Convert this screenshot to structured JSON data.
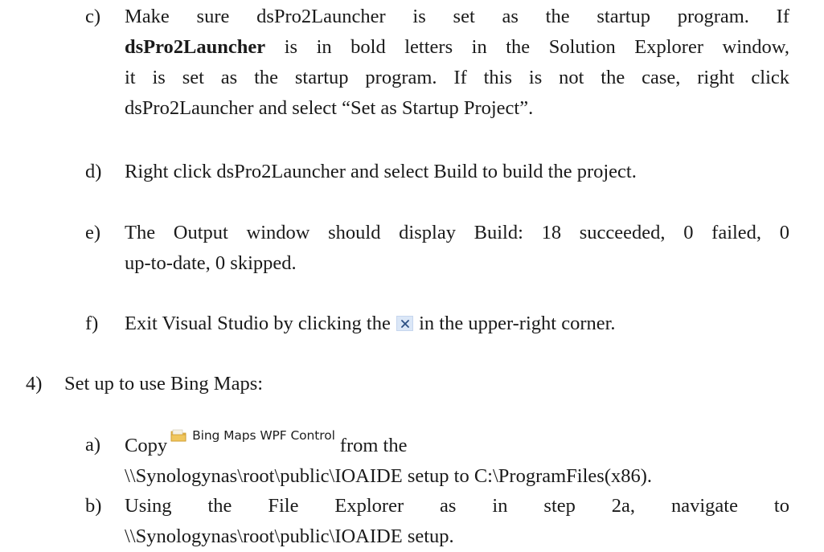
{
  "items": {
    "c": {
      "marker": "c)",
      "line1": "Make sure dsPro2Launcher is set as the startup program. If",
      "line2_bold": "dsPro2Launcher",
      "line2_rest": " is in bold letters in the Solution Explorer window,",
      "line3": "it is set as the startup program. If this is not the case, right click",
      "line4": "dsPro2Launcher and select “Set as Startup Project”."
    },
    "d": {
      "marker": "d)",
      "line1": "Right click dsPro2Launcher and select Build to build the project."
    },
    "e": {
      "marker": "e)",
      "line1": "The Output window should display Build: 18 succeeded, 0 failed, 0",
      "line2": "up-to-date, 0 skipped."
    },
    "f": {
      "marker": "f)",
      "before_icon": "Exit Visual Studio by clicking the",
      "after_icon": "in the upper-right corner.",
      "icon": "close-icon"
    },
    "step4": {
      "marker": "4)",
      "text": "Set up to use Bing Maps:"
    },
    "a4": {
      "marker": "a)",
      "before_folder": "Copy",
      "folder_icon": "folder-icon",
      "folder_label": "Bing Maps WPF Control",
      "after_folder": "from the",
      "line2": "\\\\Synologynas\\root\\public\\IOAIDE setup to C:\\ProgramFiles(x86)."
    },
    "b4": {
      "marker": "b)",
      "line1": "Using the File Explorer as in step 2a, navigate to",
      "line2": "\\\\Synologynas\\root\\public\\IOAIDE setup."
    }
  },
  "colors": {
    "text": "#1a1a1a",
    "close_icon_bg": "#dbe7f7",
    "close_icon_glyph": "#2c4f82",
    "folder": "#e8b84a"
  }
}
